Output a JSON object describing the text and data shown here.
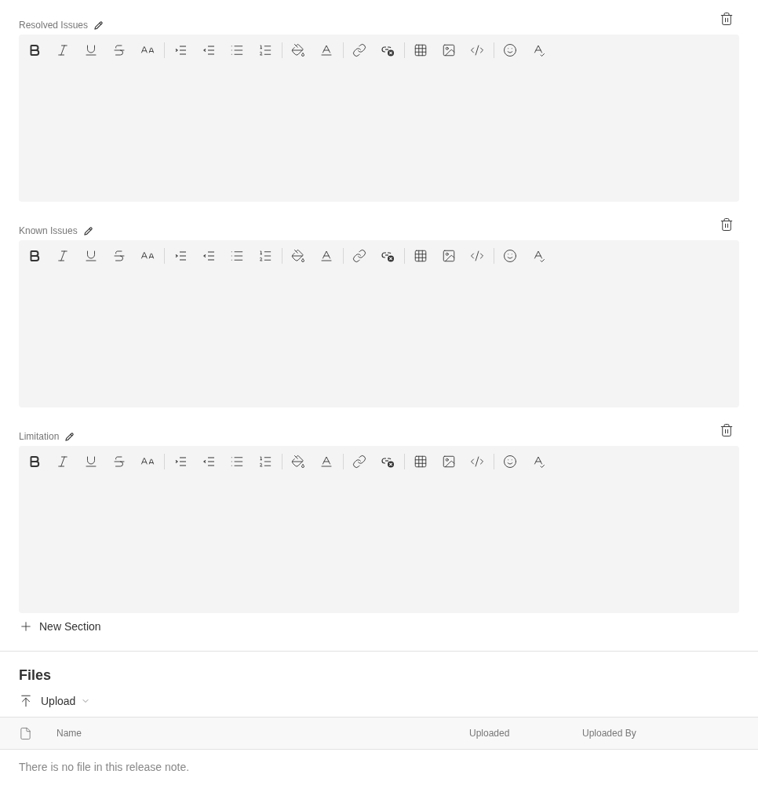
{
  "sections": [
    {
      "title": "Resolved Issues"
    },
    {
      "title": "Known Issues"
    },
    {
      "title": "Limitation"
    }
  ],
  "new_section_button": {
    "label": "New Section"
  },
  "files": {
    "title": "Files",
    "upload_button": {
      "label": "Upload"
    },
    "table": {
      "columns": [
        "Name",
        "Uploaded",
        "Uploaded By"
      ],
      "empty_message": "There is no file in this release note."
    }
  }
}
